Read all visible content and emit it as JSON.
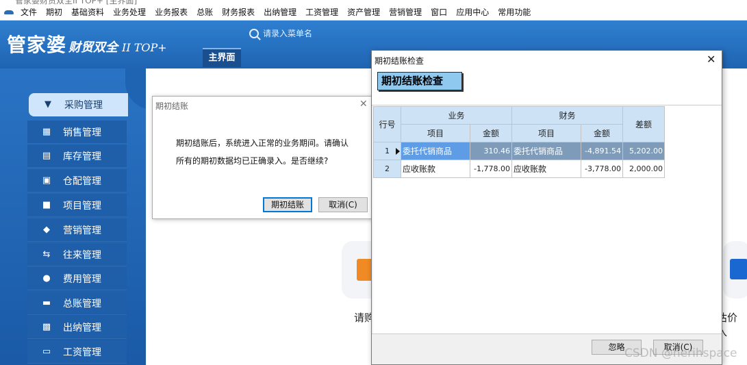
{
  "window": {
    "title_fragment": "管家婆财贸双全II TOP+ [主界面]"
  },
  "menubar": {
    "items": [
      "文件",
      "期初",
      "基础资料",
      "业务处理",
      "业务报表",
      "总账",
      "财务报表",
      "出纳管理",
      "工资管理",
      "资产管理",
      "营销管理",
      "窗口",
      "应用中心",
      "常用功能"
    ]
  },
  "header": {
    "logo_main": "管家婆",
    "logo_sub": "财贸双全",
    "logo_version": "II TOP+",
    "search_placeholder": "请录入菜单名",
    "main_tab": "主界面"
  },
  "sidebar": {
    "items": [
      {
        "label": "采购管理",
        "icon": "basket-icon",
        "active": true
      },
      {
        "label": "销售管理",
        "icon": "chart-icon"
      },
      {
        "label": "库存管理",
        "icon": "inventory-icon"
      },
      {
        "label": "仓配管理",
        "icon": "box-icon"
      },
      {
        "label": "项目管理",
        "icon": "folder-icon"
      },
      {
        "label": "营销管理",
        "icon": "tag-icon"
      },
      {
        "label": "往来管理",
        "icon": "exchange-icon"
      },
      {
        "label": "费用管理",
        "icon": "moneybag-icon"
      },
      {
        "label": "总账管理",
        "icon": "wallet-icon"
      },
      {
        "label": "出纳管理",
        "icon": "cashier-icon"
      },
      {
        "label": "工资管理",
        "icon": "card-icon"
      }
    ]
  },
  "main": {
    "caption_left": "请购",
    "caption_right": "估价入"
  },
  "dialog_close_account": {
    "title": "期初结账",
    "message_line1": "期初结账后，系统进入正常的业务期间。请确认",
    "message_line2": "所有的期初数据均已正确录入。是否继续?",
    "confirm_label": "期初结账",
    "cancel_label": "取消(C)"
  },
  "dialog_check": {
    "title": "期初结账检查",
    "heading": "期初结账检查",
    "columns": {
      "row_no": "行号",
      "business": "业务",
      "finance": "财务",
      "item": "项目",
      "amount": "金额",
      "difference": "差额"
    },
    "rows": [
      {
        "no": "1",
        "biz_item": "委托代销商品",
        "biz_amount": "310.46",
        "fin_item": "委托代销商品",
        "fin_amount": "-4,891.54",
        "diff": "5,202.00"
      },
      {
        "no": "2",
        "biz_item": "应收账款",
        "biz_amount": "-1,778.00",
        "fin_item": "应收账款",
        "fin_amount": "-3,778.00",
        "diff": "2,000.00"
      }
    ],
    "ignore_label": "忽略",
    "cancel_label": "取消(C)"
  },
  "watermark": "CSDN @herihspace"
}
